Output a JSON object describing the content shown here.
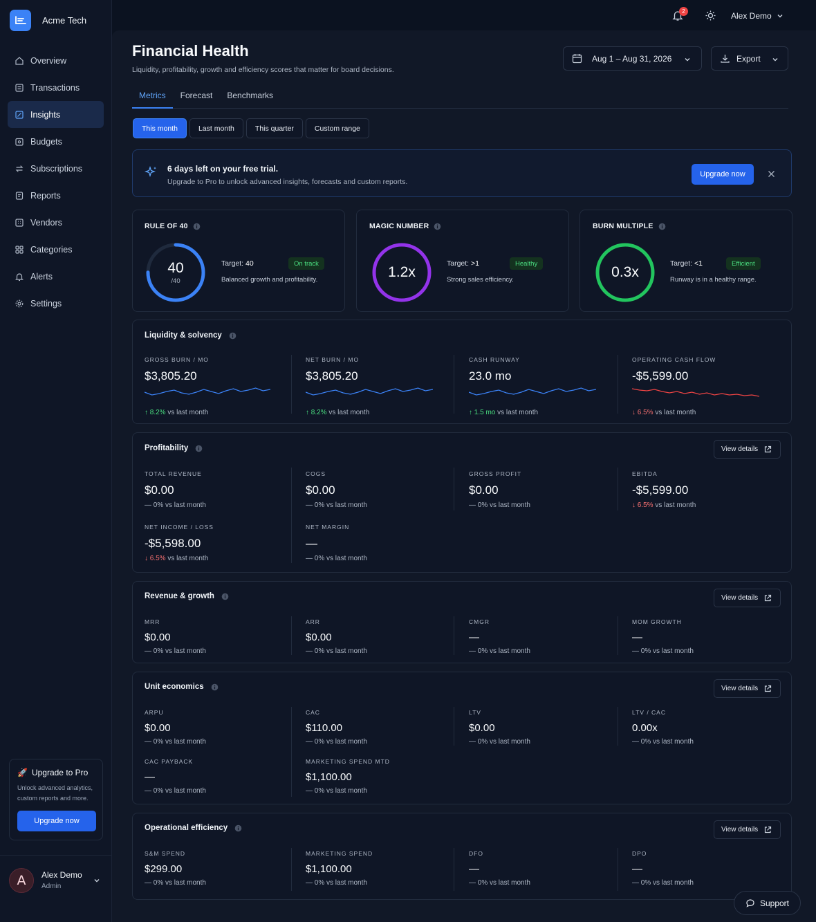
{
  "brand": {
    "name": "Acme Tech"
  },
  "sidebar": {
    "items": [
      {
        "label": "Overview",
        "icon": "home-icon"
      },
      {
        "label": "Transactions",
        "icon": "receipt-icon"
      },
      {
        "label": "Insights",
        "icon": "insights-icon",
        "active": true
      },
      {
        "label": "Budgets",
        "icon": "wallet-icon"
      },
      {
        "label": "Subscriptions",
        "icon": "repeat-icon"
      },
      {
        "label": "Reports",
        "icon": "report-icon"
      },
      {
        "label": "Vendors",
        "icon": "building-icon"
      },
      {
        "label": "Categories",
        "icon": "grid-icon"
      },
      {
        "label": "Alerts",
        "icon": "bell-icon"
      },
      {
        "label": "Settings",
        "icon": "gear-icon"
      }
    ],
    "upgrade": {
      "title": "Upgrade to Pro",
      "desc_line1": "Unlock advanced analytics,",
      "desc_line2": "custom reports and more.",
      "button": "Upgrade now"
    },
    "user": {
      "initial": "A",
      "name": "Alex Demo",
      "role": "Admin"
    }
  },
  "topbar": {
    "notifications": "2",
    "user": "Alex Demo"
  },
  "header": {
    "title": "Financial Health",
    "subtitle": "Liquidity, profitability, growth and efficiency scores that matter for board decisions.",
    "date_range": "Aug 1 – Aug 31, 2026",
    "export": "Export"
  },
  "tabs": [
    "Metrics",
    "Forecast",
    "Benchmarks"
  ],
  "ranges": [
    "This month",
    "Last month",
    "This quarter",
    "Custom range"
  ],
  "trial": {
    "title": "6 days left on your free trial.",
    "desc": "Upgrade to Pro to unlock advanced insights, forecasts and custom reports.",
    "button": "Upgrade now"
  },
  "scores": [
    {
      "title": "RULE OF 40",
      "value": "40",
      "sub": "/40",
      "target_label": "Target:",
      "target": "40",
      "badge": "On track",
      "desc": "Balanced growth and profitability.",
      "color": "#3b82f6",
      "fill": 0.75
    },
    {
      "title": "MAGIC NUMBER",
      "value": "1.2x",
      "sub": "",
      "target_label": "Target:",
      "target": ">1",
      "badge": "Healthy",
      "desc": "Strong sales efficiency.",
      "color": "#9333ea",
      "fill": 1.0
    },
    {
      "title": "BURN MULTIPLE",
      "value": "0.3x",
      "sub": "",
      "target_label": "Target:",
      "target": "<1",
      "badge": "Efficient",
      "desc": "Runway is in a healthy range.",
      "color": "#22c55e",
      "fill": 1.0
    }
  ],
  "liquidity": {
    "title": "Liquidity & solvency",
    "metrics": [
      {
        "label": "GROSS BURN / MO",
        "value": "$3,805.20",
        "delta": "8.2%",
        "dir": "up",
        "suffix": "vs last month",
        "color": "#3b82f6"
      },
      {
        "label": "NET BURN / MO",
        "value": "$3,805.20",
        "delta": "8.2%",
        "dir": "up",
        "suffix": "vs last month",
        "color": "#3b82f6"
      },
      {
        "label": "CASH RUNWAY",
        "value": "23.0 mo",
        "delta": "1.5 mo",
        "dir": "up",
        "suffix": "vs last month",
        "color": "#3b82f6"
      },
      {
        "label": "OPERATING CASH FLOW",
        "value": "-$5,599.00",
        "delta": "6.5%",
        "dir": "down",
        "suffix": "vs last month",
        "color": "#ef4444"
      }
    ]
  },
  "profitability": {
    "title": "Profitability",
    "view": "View details",
    "metrics": [
      {
        "label": "TOTAL REVENUE",
        "value": "$0.00",
        "delta": "0%",
        "dir": "flat",
        "suffix": "vs last month"
      },
      {
        "label": "COGS",
        "value": "$0.00",
        "delta": "0%",
        "dir": "flat",
        "suffix": "vs last month"
      },
      {
        "label": "GROSS PROFIT",
        "value": "$0.00",
        "delta": "0%",
        "dir": "flat",
        "suffix": "vs last month"
      },
      {
        "label": "EBITDA",
        "value": "-$5,599.00",
        "delta": "6.5%",
        "dir": "down",
        "suffix": "vs last month"
      },
      {
        "label": "NET INCOME / LOSS",
        "value": "-$5,598.00",
        "delta": "6.5%",
        "dir": "down",
        "suffix": "vs last month"
      },
      {
        "label": "NET MARGIN",
        "value": "—",
        "delta": "0%",
        "dir": "flat",
        "suffix": "vs last month"
      }
    ]
  },
  "revenue": {
    "title": "Revenue & growth",
    "view": "View details",
    "metrics": [
      {
        "label": "MRR",
        "value": "$0.00",
        "delta": "0%",
        "dir": "flat",
        "suffix": "vs last month"
      },
      {
        "label": "ARR",
        "value": "$0.00",
        "delta": "0%",
        "dir": "flat",
        "suffix": "vs last month"
      },
      {
        "label": "CMGR",
        "value": "—",
        "delta": "0%",
        "dir": "flat",
        "suffix": "vs last month"
      },
      {
        "label": "MOM GROWTH",
        "value": "—",
        "delta": "0%",
        "dir": "flat",
        "suffix": "vs last month"
      }
    ]
  },
  "unit": {
    "title": "Unit economics",
    "view": "View details",
    "metrics": [
      {
        "label": "ARPU",
        "value": "$0.00",
        "delta": "0%",
        "dir": "flat",
        "suffix": "vs last month"
      },
      {
        "label": "CAC",
        "value": "$110.00",
        "delta": "0%",
        "dir": "flat",
        "suffix": "vs last month"
      },
      {
        "label": "LTV",
        "value": "$0.00",
        "delta": "0%",
        "dir": "flat",
        "suffix": "vs last month"
      },
      {
        "label": "LTV / CAC",
        "value": "0.00x",
        "delta": "0%",
        "dir": "flat",
        "suffix": "vs last month"
      },
      {
        "label": "CAC PAYBACK",
        "value": "—",
        "delta": "0%",
        "dir": "flat",
        "suffix": "vs last month"
      },
      {
        "label": "MARKETING SPEND MTD",
        "value": "$1,100.00",
        "delta": "0%",
        "dir": "flat",
        "suffix": "vs last month"
      }
    ]
  },
  "ops": {
    "title": "Operational efficiency",
    "view": "View details",
    "metrics": [
      {
        "label": "S&M SPEND",
        "value": "$299.00",
        "delta": "0%",
        "dir": "flat",
        "suffix": "vs last month"
      },
      {
        "label": "MARKETING SPEND",
        "value": "$1,100.00",
        "delta": "0%",
        "dir": "flat",
        "suffix": "vs last month"
      },
      {
        "label": "DFO",
        "value": "—",
        "delta": "0%",
        "dir": "flat",
        "suffix": "vs last month"
      },
      {
        "label": "DPO",
        "value": "—",
        "delta": "0%",
        "dir": "flat",
        "suffix": "vs last month"
      }
    ]
  },
  "support": {
    "label": "Support"
  }
}
